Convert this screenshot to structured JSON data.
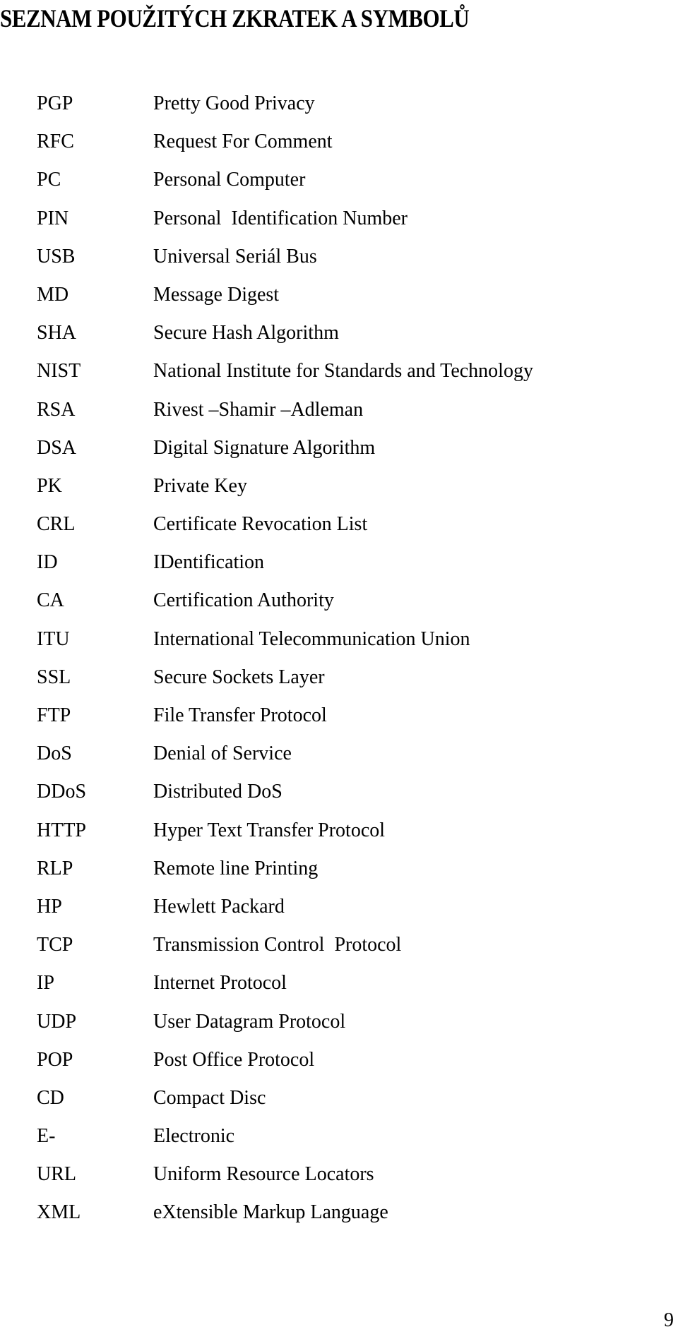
{
  "document": {
    "title": "SEZNAM POUŽITÝCH ZKRATEK A SYMBOLŮ",
    "page_number": "9",
    "abbreviations": [
      {
        "term": "PGP",
        "definition": "Pretty Good Privacy"
      },
      {
        "term": "RFC",
        "definition": "Request For Comment"
      },
      {
        "term": "PC",
        "definition": "Personal Computer"
      },
      {
        "term": "PIN",
        "definition": "Personal  Identification Number"
      },
      {
        "term": "USB",
        "definition": "Universal Seriál Bus"
      },
      {
        "term": "MD",
        "definition": "Message Digest"
      },
      {
        "term": "SHA",
        "definition": "Secure Hash Algorithm"
      },
      {
        "term": "NIST",
        "definition": "National Institute for Standards and Technology"
      },
      {
        "term": "RSA",
        "definition": "Rivest –Shamir –Adleman"
      },
      {
        "term": "DSA",
        "definition": "Digital Signature Algorithm"
      },
      {
        "term": "PK",
        "definition": "Private Key"
      },
      {
        "term": "CRL",
        "definition": "Certificate Revocation List"
      },
      {
        "term": "ID",
        "definition": "IDentification"
      },
      {
        "term": "CA",
        "definition": "Certification Authority"
      },
      {
        "term": "ITU",
        "definition": "International Telecommunication Union"
      },
      {
        "term": "SSL",
        "definition": "Secure Sockets Layer"
      },
      {
        "term": "FTP",
        "definition": "File Transfer Protocol"
      },
      {
        "term": "DoS",
        "definition": "Denial of Service"
      },
      {
        "term": "DDoS",
        "definition": "Distributed DoS"
      },
      {
        "term": "HTTP",
        "definition": "Hyper Text Transfer Protocol"
      },
      {
        "term": "RLP",
        "definition": "Remote line Printing"
      },
      {
        "term": "HP",
        "definition": "Hewlett Packard"
      },
      {
        "term": "TCP",
        "definition": "Transmission Control  Protocol"
      },
      {
        "term": "IP",
        "definition": "Internet Protocol"
      },
      {
        "term": "UDP",
        "definition": "User Datagram Protocol"
      },
      {
        "term": "POP",
        "definition": "Post Office Protocol"
      },
      {
        "term": "CD",
        "definition": "Compact Disc"
      },
      {
        "term": "E-",
        "definition": "Electronic"
      },
      {
        "term": "URL",
        "definition": "Uniform Resource Locators"
      },
      {
        "term": "XML",
        "definition": "eXtensible Markup Language"
      }
    ]
  }
}
